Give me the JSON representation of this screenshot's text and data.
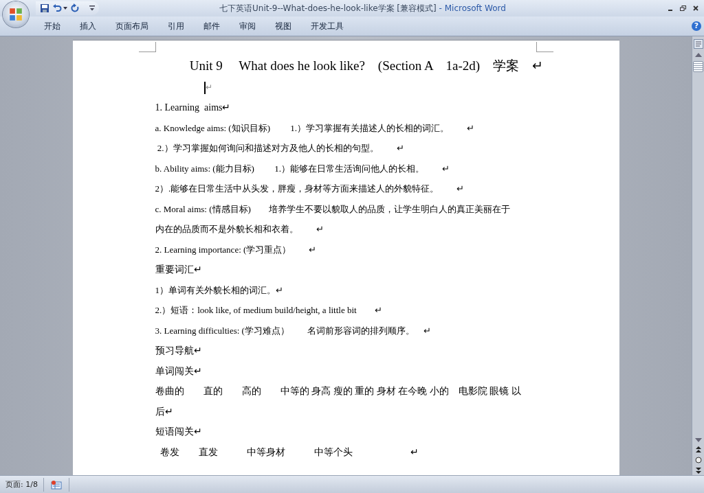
{
  "window": {
    "title": "七下英语Unit-9--What-does-he-look-like学案 [兼容模式]",
    "app": " - Microsoft Word"
  },
  "ribbon_tabs": [
    "开始",
    "插入",
    "页面布局",
    "引用",
    "邮件",
    "审阅",
    "视图",
    "开发工具"
  ],
  "help_button": "?",
  "document": {
    "lines": [
      {
        "kind": "title",
        "text": "Unit 9　 What does he look like?　(Section A　1a-2d)　学案　↵"
      },
      {
        "kind": "cursor",
        "text": "↵"
      },
      {
        "kind": "normal",
        "text": "1. Learning  aims↵"
      },
      {
        "kind": "small",
        "text": "a. Knowledge aims: (知识目标)　　 1.）学习掌握有关描述人的长相的词汇。　　↵"
      },
      {
        "kind": "small",
        "text": " 2.）学习掌握如何询问和描述对方及他人的长相的句型。　　↵"
      },
      {
        "kind": "small",
        "text": "b. Ability aims: (能力目标)　　 1.）能够在日常生活询问他人的长相。　　↵"
      },
      {
        "kind": "small",
        "text": "2）.能够在日常生活中从头发，胖瘦，身材等方面来描述人的外貌特征。　　↵"
      },
      {
        "kind": "small",
        "text": "c. Moral aims: (情感目标)　　培养学生不要以貌取人的品质，让学生明白人的真正美丽在于"
      },
      {
        "kind": "small",
        "text": "内在的品质而不是外貌长相和衣着。　　↵"
      },
      {
        "kind": "small",
        "text": "2. Learning importance: (学习重点）　　↵"
      },
      {
        "kind": "normal",
        "text": "重要词汇↵"
      },
      {
        "kind": "small",
        "text": "1）单词有关外貌长相的词汇。↵"
      },
      {
        "kind": "small",
        "text": "2.）短语：look like, of medium build/height, a little bit　　↵"
      },
      {
        "kind": "small",
        "text": "3. Learning difficulties: (学习难点）　　名词前形容词的排列顺序。　↵"
      },
      {
        "kind": "normal",
        "text": "预习导航↵"
      },
      {
        "kind": "normal",
        "text": "单词闯关↵"
      },
      {
        "kind": "normal",
        "text": "卷曲的　　直的　　高的　　中等的 身高 瘦的 重的 身材 在今晚 小的　电影院 眼镜 以"
      },
      {
        "kind": "normal",
        "text": "后↵"
      },
      {
        "kind": "normal",
        "text": "短语闯关↵"
      },
      {
        "kind": "normal",
        "text": "  卷发　　直发　　　中等身材　　　中等个头　　　　　　↵"
      }
    ]
  },
  "status_bar": {
    "page": "页面: 1/8"
  }
}
